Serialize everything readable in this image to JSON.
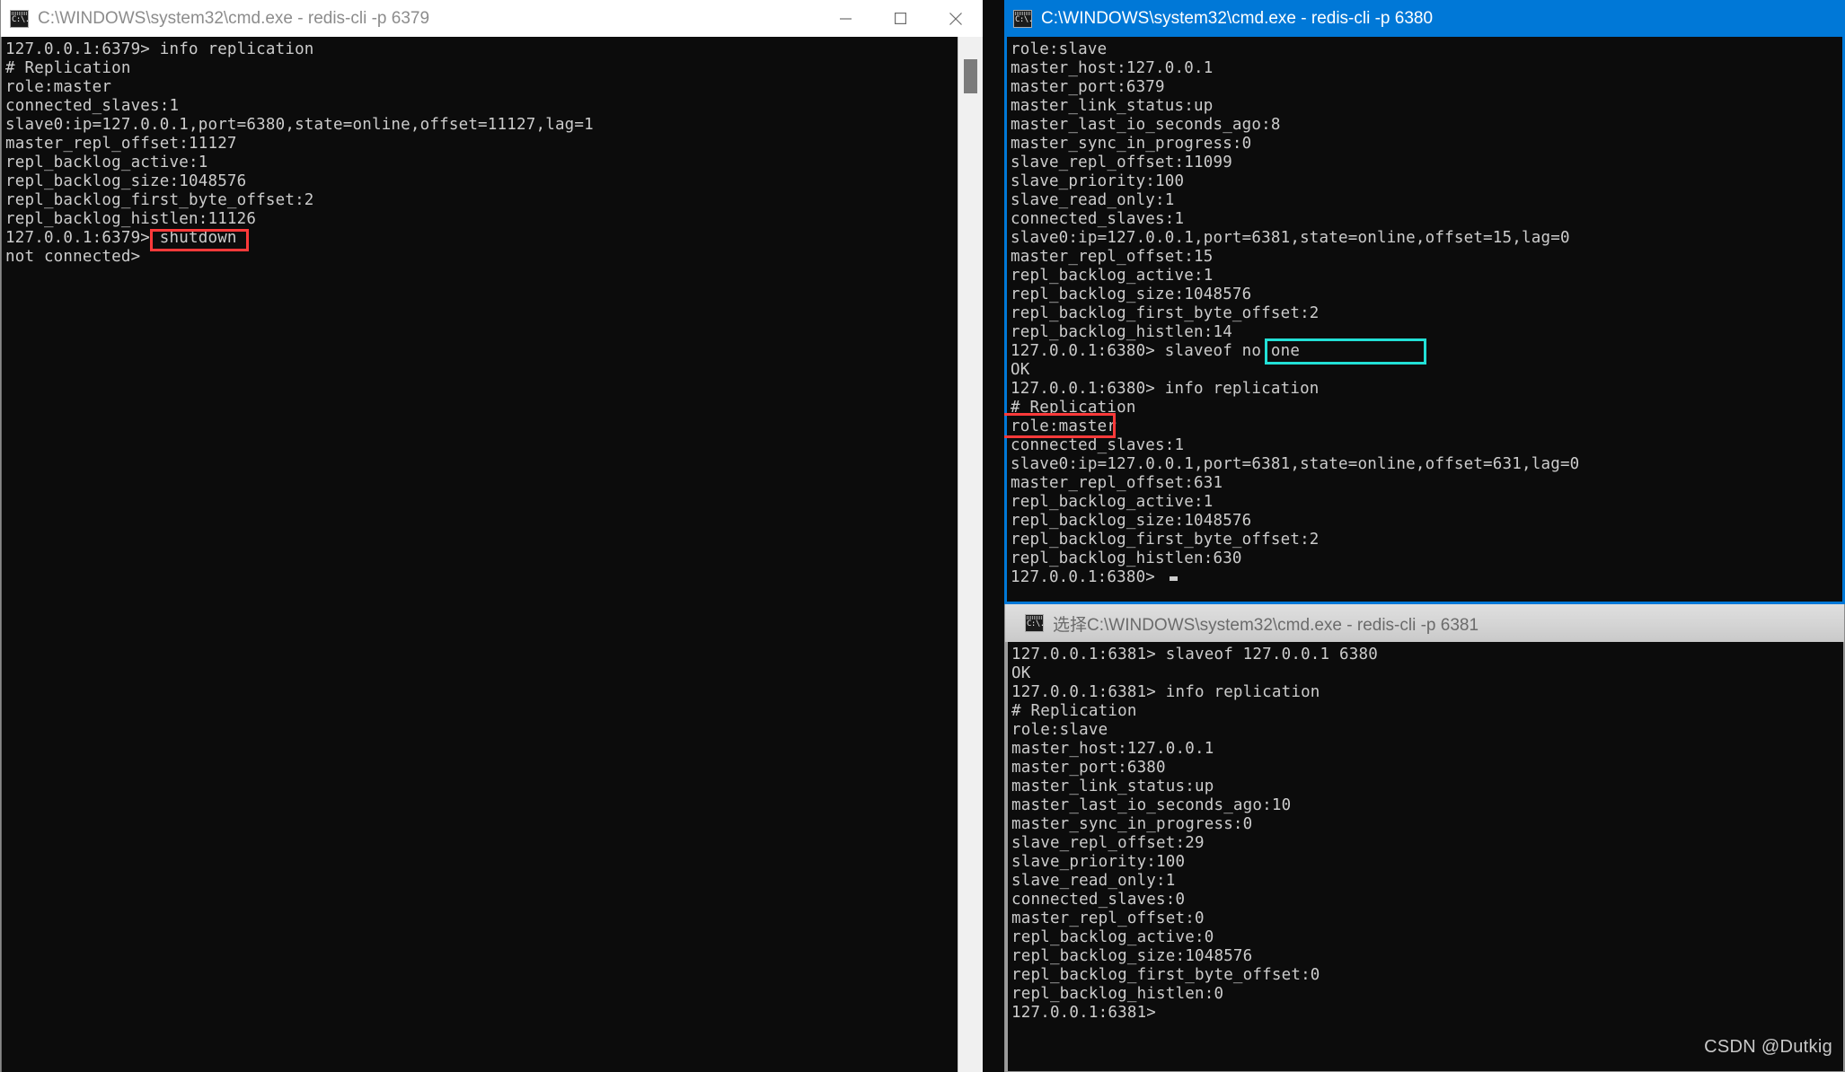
{
  "watermark": "CSDN @Dutkig",
  "window1": {
    "title": "C:\\WINDOWS\\system32\\cmd.exe - redis-cli  -p 6379",
    "icon": "cmd-icon",
    "controls": {
      "minimize": "minimize-icon",
      "maximize": "maximize-icon",
      "close": "close-icon"
    },
    "lines": [
      "127.0.0.1:6379> info replication",
      "# Replication",
      "role:master",
      "connected_slaves:1",
      "slave0:ip=127.0.0.1,port=6380,state=online,offset=11127,lag=1",
      "master_repl_offset:11127",
      "repl_backlog_active:1",
      "repl_backlog_size:1048576",
      "repl_backlog_first_byte_offset:2",
      "repl_backlog_histlen:11126",
      "127.0.0.1:6379> shutdown",
      "not connected>"
    ],
    "annotation": {
      "label": "shutdown",
      "color": "#ff3a3a"
    }
  },
  "window2": {
    "title": "C:\\WINDOWS\\system32\\cmd.exe - redis-cli  -p 6380",
    "icon": "cmd-icon",
    "lines": [
      "role:slave",
      "master_host:127.0.0.1",
      "master_port:6379",
      "master_link_status:up",
      "master_last_io_seconds_ago:8",
      "master_sync_in_progress:0",
      "slave_repl_offset:11099",
      "slave_priority:100",
      "slave_read_only:1",
      "connected_slaves:1",
      "slave0:ip=127.0.0.1,port=6381,state=online,offset=15,lag=0",
      "master_repl_offset:15",
      "repl_backlog_active:1",
      "repl_backlog_size:1048576",
      "repl_backlog_first_byte_offset:2",
      "repl_backlog_histlen:14",
      "127.0.0.1:6380> slaveof no one",
      "OK",
      "127.0.0.1:6380> info replication",
      "# Replication",
      "role:master",
      "connected_slaves:1",
      "slave0:ip=127.0.0.1,port=6381,state=online,offset=631,lag=0",
      "master_repl_offset:631",
      "repl_backlog_active:1",
      "repl_backlog_size:1048576",
      "repl_backlog_first_byte_offset:2",
      "repl_backlog_histlen:630",
      "127.0.0.1:6380>"
    ],
    "annotations": [
      {
        "label": "slaveof no one",
        "color": "#22e0d6"
      },
      {
        "label": "role:master",
        "color": "#ff3a3a"
      }
    ]
  },
  "window3": {
    "title": "选择C:\\WINDOWS\\system32\\cmd.exe - redis-cli  -p 6381",
    "icon": "cmd-icon",
    "lines": [
      "127.0.0.1:6381> slaveof 127.0.0.1 6380",
      "OK",
      "127.0.0.1:6381> info replication",
      "# Replication",
      "role:slave",
      "master_host:127.0.0.1",
      "master_port:6380",
      "master_link_status:up",
      "master_last_io_seconds_ago:10",
      "master_sync_in_progress:0",
      "slave_repl_offset:29",
      "slave_priority:100",
      "slave_read_only:1",
      "connected_slaves:0",
      "master_repl_offset:0",
      "repl_backlog_active:0",
      "repl_backlog_size:1048576",
      "repl_backlog_first_byte_offset:0",
      "repl_backlog_histlen:0",
      "127.0.0.1:6381>"
    ]
  }
}
